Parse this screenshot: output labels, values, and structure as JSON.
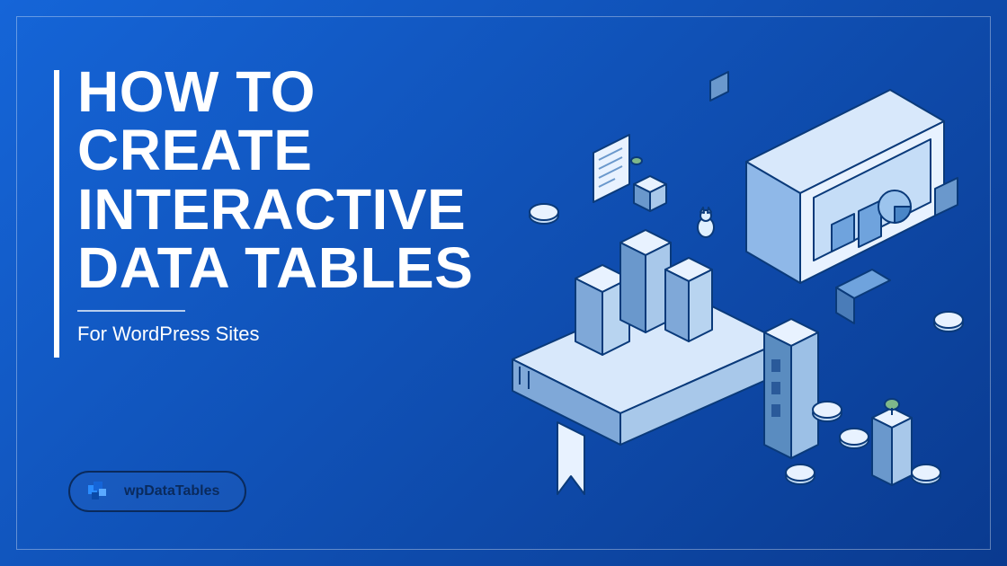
{
  "headline": "HOW TO CREATE INTERACTIVE DATA TABLES",
  "subtitle": "For WordPress Sites",
  "brand": "wpDataTables",
  "colors": {
    "bg_start": "#1565d8",
    "bg_end": "#0a3a8f",
    "text": "#ffffff",
    "pill_border": "#0a2a5c"
  }
}
